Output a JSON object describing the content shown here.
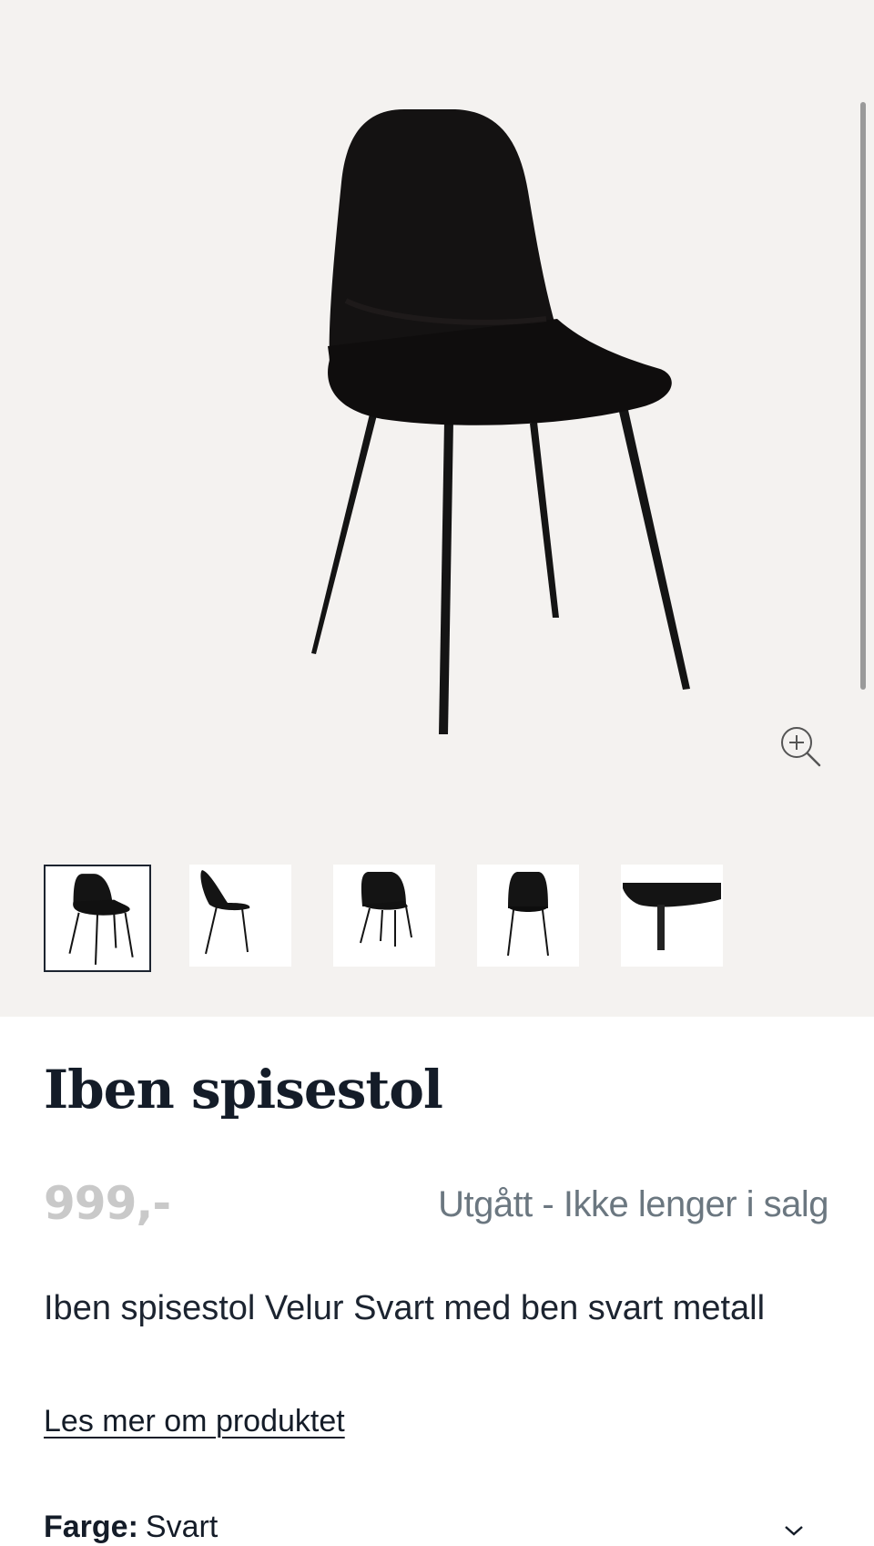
{
  "gallery": {
    "zoom_icon": "zoom-in-icon",
    "thumbnails": [
      {
        "label": "front-angle"
      },
      {
        "label": "side"
      },
      {
        "label": "back-angle"
      },
      {
        "label": "front"
      },
      {
        "label": "detail"
      }
    ],
    "active_index": 0
  },
  "product": {
    "title": "Iben spisestol",
    "price": "999,-",
    "status": "Utgått - Ikke lenger i salg",
    "description": "Iben spisestol Velur Svart med ben svart metall",
    "read_more": "Les mer om produktet",
    "color_label": "Farge:",
    "color_value": "Svart"
  },
  "colors": {
    "gallery_bg": "#f4f2f0",
    "title": "#141c28",
    "price": "#c9c9c9",
    "status": "#6b7780"
  }
}
